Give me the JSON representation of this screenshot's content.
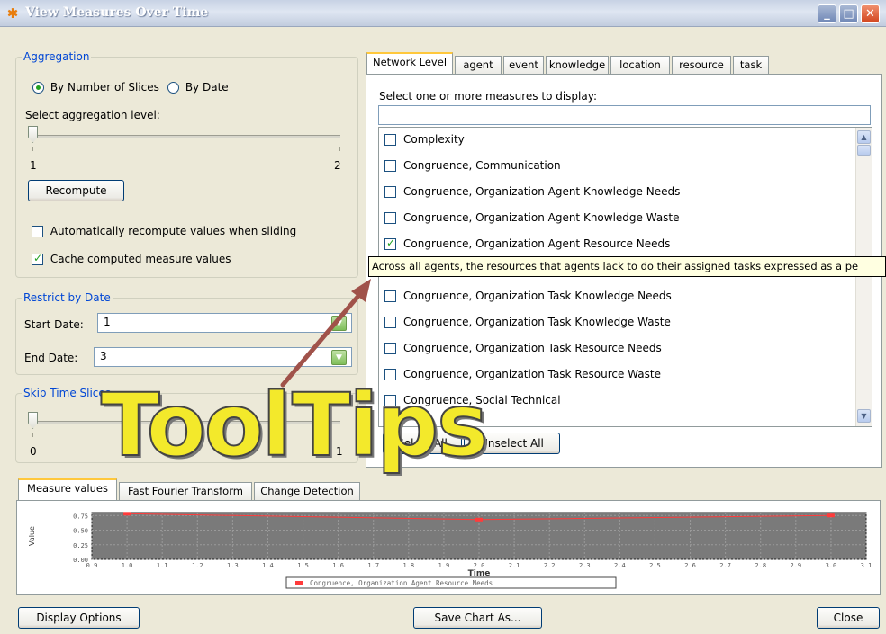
{
  "window": {
    "title": "View Measures Over Time",
    "buttons": {
      "minimize": "_",
      "maximize": "□",
      "close": "✕"
    }
  },
  "aggregation": {
    "legend": "Aggregation",
    "radio_slices": "By Number of Slices",
    "radio_date": "By Date",
    "level_label": "Select aggregation level:",
    "slider_min": "1",
    "slider_max": "2",
    "slider_value_fraction": 0,
    "recompute_label": "Recompute",
    "auto_recompute_label": "Automatically recompute values when sliding",
    "auto_recompute_checked": false,
    "cache_label": "Cache computed measure values",
    "cache_checked": true
  },
  "restrict": {
    "legend": "Restrict by Date",
    "start_label": "Start Date:",
    "start_value": "1",
    "end_label": "End Date:",
    "end_value": "3"
  },
  "skip": {
    "legend": "Skip Time Slices",
    "slider_min": "0",
    "slider_max": "1"
  },
  "measure_tabs": [
    "Network Level",
    "agent",
    "event",
    "knowledge",
    "location",
    "resource",
    "task"
  ],
  "measure_list": {
    "prompt": "Select one or more measures to display:",
    "filter_value": "",
    "items": [
      {
        "label": "Complexity",
        "checked": false
      },
      {
        "label": "Congruence, Communication",
        "checked": false
      },
      {
        "label": "Congruence, Organization Agent Knowledge Needs",
        "checked": false
      },
      {
        "label": "Congruence, Organization Agent Knowledge Waste",
        "checked": false
      },
      {
        "label": "Congruence, Organization Agent Resource Needs",
        "checked": true
      },
      {
        "label": "",
        "checked": false
      },
      {
        "label": "Congruence, Organization Task Knowledge Needs",
        "checked": false
      },
      {
        "label": "Congruence, Organization Task Knowledge Waste",
        "checked": false
      },
      {
        "label": "Congruence, Organization Task Resource Needs",
        "checked": false
      },
      {
        "label": "Congruence, Organization Task Resource Waste",
        "checked": false
      },
      {
        "label": "Congruence, Social Technical",
        "checked": false
      },
      {
        "label": "",
        "checked": false
      }
    ],
    "select_all": "Select All",
    "unselect_all": "Unselect All"
  },
  "tooltip": "Across all agents, the resources that agents lack to do their assigned tasks expressed as a pe",
  "overlay_text": {
    "word1": "Tool",
    "word2": "Tips"
  },
  "bottom_tabs": [
    "Measure values",
    "Fast Fourier Transform",
    "Change Detection"
  ],
  "footer": {
    "display_options": "Display Options",
    "save_chart": "Save Chart As...",
    "close": "Close"
  },
  "chart_data": {
    "type": "line",
    "title": "",
    "xlabel": "Time",
    "ylabel": "Value",
    "x_ticks": [
      "0.9",
      "1.0",
      "1.1",
      "1.2",
      "1.3",
      "1.4",
      "1.5",
      "1.6",
      "1.7",
      "1.8",
      "1.9",
      "2.0",
      "2.1",
      "2.2",
      "2.3",
      "2.4",
      "2.5",
      "2.6",
      "2.7",
      "2.8",
      "2.9",
      "3.0",
      "3.1"
    ],
    "y_ticks": [
      "0.75",
      "0.50",
      "0.25",
      "0.00"
    ],
    "xlim": [
      0.9,
      3.1
    ],
    "ylim": [
      0.0,
      0.8
    ],
    "grid": true,
    "series": [
      {
        "name": "Congruence, Organization Agent Resource Needs",
        "color": "#ff3b3b",
        "x": [
          1.0,
          2.0,
          3.0
        ],
        "y": [
          0.78,
          0.68,
          0.75
        ]
      }
    ],
    "legend_position": "bottom-center"
  },
  "colors": {
    "accent_tab": "#ffc83c",
    "legend_text": "#0046d5",
    "arrow": "#a0524a",
    "overlay_yellow": "#f3e92b"
  }
}
